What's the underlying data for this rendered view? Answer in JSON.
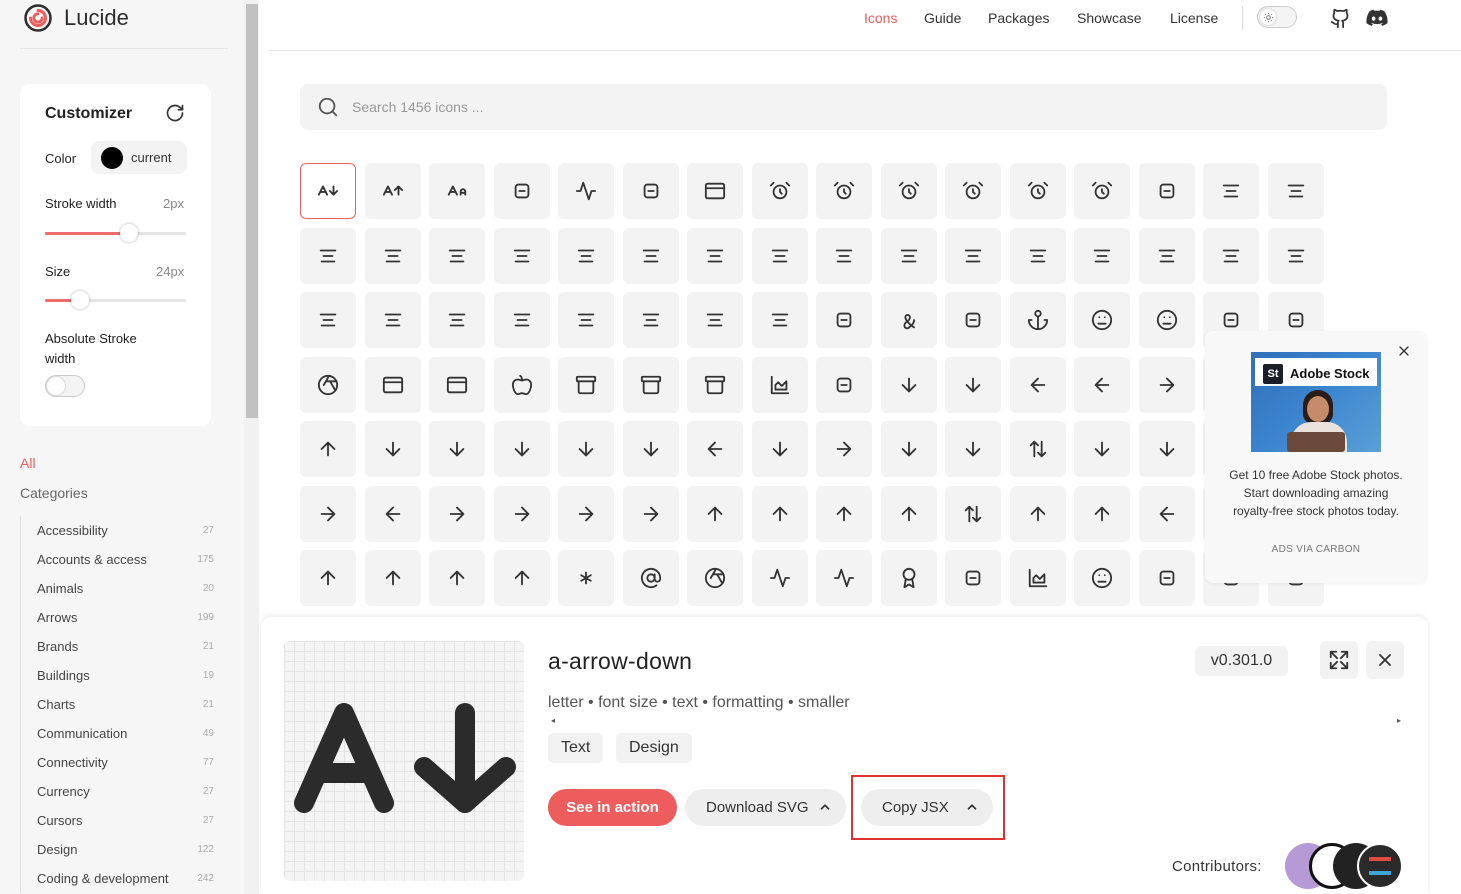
{
  "logo": {
    "title": "Lucide"
  },
  "nav": {
    "items": [
      {
        "label": "Icons",
        "active": true
      },
      {
        "label": "Guide"
      },
      {
        "label": "Packages"
      },
      {
        "label": "Showcase"
      },
      {
        "label": "License"
      }
    ],
    "icons": [
      "sun-icon",
      "github-icon",
      "discord-icon"
    ]
  },
  "customizer": {
    "title": "Customizer",
    "color_label": "Color",
    "color_value": "current",
    "stroke_label": "Stroke width",
    "stroke_value": "2px",
    "size_label": "Size",
    "size_value": "24px",
    "absolute_label": "Absolute Stroke width",
    "absolute_enabled": false
  },
  "sidebar": {
    "all_label": "All",
    "categories_label": "Categories",
    "categories": [
      {
        "name": "Accessibility",
        "count": "27"
      },
      {
        "name": "Accounts & access",
        "count": "175"
      },
      {
        "name": "Animals",
        "count": "20"
      },
      {
        "name": "Arrows",
        "count": "199"
      },
      {
        "name": "Brands",
        "count": "21"
      },
      {
        "name": "Buildings",
        "count": "19"
      },
      {
        "name": "Charts",
        "count": "21"
      },
      {
        "name": "Communication",
        "count": "49"
      },
      {
        "name": "Connectivity",
        "count": "77"
      },
      {
        "name": "Currency",
        "count": "27"
      },
      {
        "name": "Cursors",
        "count": "27"
      },
      {
        "name": "Design",
        "count": "122"
      },
      {
        "name": "Coding & development",
        "count": "242"
      }
    ]
  },
  "search": {
    "placeholder": "Search 1456 icons ..."
  },
  "grid": {
    "selected_index": 0,
    "icons": [
      "a-arrow-down",
      "a-arrow-up",
      "a-large-small",
      "accessibility",
      "activity",
      "air-vent",
      "airplay",
      "alarm-clock",
      "alarm-clock-check",
      "alarm-clock-minus",
      "alarm-clock-off",
      "alarm-clock-plus",
      "alarm-smoke",
      "album",
      "align-center",
      "align-center-horizontal",
      "align-center-vertical",
      "align-end-horizontal",
      "align-end-vertical",
      "align-horizontal-distribute-center",
      "align-horizontal-distribute-end",
      "align-horizontal-distribute-start",
      "align-horizontal-justify-center",
      "align-horizontal-justify-end",
      "align-horizontal-justify-start",
      "align-horizontal-space-around",
      "align-horizontal-space-between",
      "align-justify",
      "align-left",
      "align-right",
      "align-start-horizontal",
      "align-start-vertical",
      "align-vertical-distribute-center",
      "align-vertical-distribute-end",
      "align-vertical-distribute-start",
      "align-vertical-justify-center",
      "align-vertical-justify-end",
      "align-vertical-justify-start",
      "align-vertical-space-around",
      "align-vertical-space-between",
      "ambulance",
      "ampersand",
      "ampersands",
      "anchor",
      "angry",
      "annoyed",
      "antenna",
      "anvil",
      "aperture",
      "app-window",
      "app-window-mac",
      "apple",
      "archive",
      "archive-restore",
      "archive-x",
      "area-chart",
      "armchair",
      "arrow-big-down",
      "arrow-big-down-dash",
      "arrow-big-left",
      "arrow-big-left-dash",
      "arrow-big-right",
      "arrow-big-right-dash",
      "arrow-big-up",
      "arrow-big-up-dash",
      "arrow-down",
      "arrow-down-0-1",
      "arrow-down-1-0",
      "arrow-down-a-z",
      "arrow-down-from-line",
      "arrow-down-left",
      "arrow-down-narrow-wide",
      "arrow-down-right",
      "arrow-down-to-dot",
      "arrow-down-to-line",
      "arrow-down-up",
      "arrow-down-wide-narrow",
      "arrow-down-z-a",
      "arrow-left",
      "arrow-left-from-line",
      "arrow-left-right",
      "arrow-left-to-line",
      "arrow-right",
      "arrow-right-from-line",
      "arrow-right-left",
      "arrow-right-to-line",
      "arrow-up",
      "arrow-up-0-1",
      "arrow-up-1-0",
      "arrow-up-a-z",
      "arrow-up-down",
      "arrow-up-from-dot",
      "arrow-up-from-line",
      "arrow-up-left",
      "arrow-up-narrow-wide",
      "arrow-up-right",
      "arrow-up-to-line",
      "arrow-up-wide-narrow",
      "arrow-up-z-a",
      "arrows-up-from-line",
      "asterisk",
      "at-sign",
      "atom",
      "audio-lines",
      "audio-waveform",
      "award",
      "axe",
      "axis-3d",
      "baby",
      "backpack",
      "badge",
      "badge-alert"
    ]
  },
  "ad": {
    "brand_badge": "St",
    "brand": "Adobe Stock",
    "text": "Get 10 free Adobe Stock photos. Start downloading amazing royalty-free stock photos today.",
    "via": "ADS VIA CARBON"
  },
  "detail": {
    "title": "a-arrow-down",
    "tags": "letter • font size • text • formatting • smaller",
    "categories": [
      "Text",
      "Design"
    ],
    "version": "v0.301.0",
    "see_in_action": "See in action",
    "download_svg": "Download SVG",
    "copy_jsx": "Copy JSX",
    "contributors_label": "Contributors:"
  }
}
